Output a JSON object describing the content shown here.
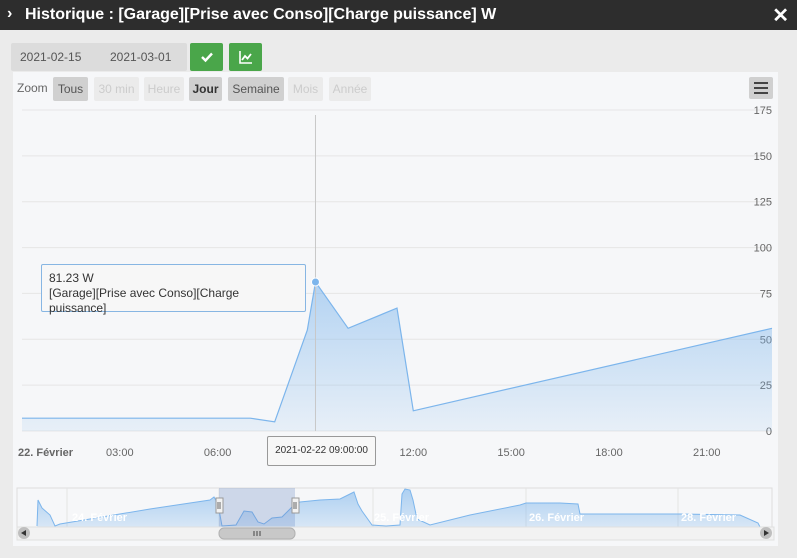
{
  "window": {
    "title": "Historique : [Garage][Prise avec Conso][Charge puissance] W"
  },
  "controls": {
    "date_start": "2021-02-15",
    "date_end": "2021-03-01"
  },
  "zoom": {
    "label": "Zoom",
    "buttons": [
      {
        "label": "Tous",
        "enabled": true,
        "selected": false
      },
      {
        "label": "30 min",
        "enabled": false,
        "selected": false
      },
      {
        "label": "Heure",
        "enabled": false,
        "selected": false
      },
      {
        "label": "Jour",
        "enabled": true,
        "selected": true
      },
      {
        "label": "Semaine",
        "enabled": true,
        "selected": false
      },
      {
        "label": "Mois",
        "enabled": false,
        "selected": false
      },
      {
        "label": "Année",
        "enabled": false,
        "selected": false
      }
    ]
  },
  "tooltip": {
    "value": "81.23 W",
    "series": "[Garage][Prise avec Conso][Charge puissance]"
  },
  "crosshair_label": "2021-02-22 09:00:00",
  "navigator": {
    "labels": [
      "24. Février",
      "25. Février",
      "26. Février",
      "28. Février"
    ]
  },
  "colors": {
    "line": "#7cb5ec",
    "accent_green": "#4aa64a",
    "titlebar": "#2d2d2d"
  },
  "chart_data": {
    "type": "area",
    "series": [
      {
        "name": "[Garage][Prise avec Conso][Charge puissance]",
        "unit": "W",
        "x": [
          "2021-02-22 00:00",
          "2021-02-22 07:00",
          "2021-02-22 07:45",
          "2021-02-22 08:45",
          "2021-02-22 09:00",
          "2021-02-22 10:00",
          "2021-02-22 11:30",
          "2021-02-22 12:00",
          "2021-02-22 23:00"
        ],
        "y": [
          7,
          7,
          5,
          55,
          81.23,
          56,
          67,
          11,
          56
        ]
      }
    ],
    "x_tick_labels": [
      "22. Février",
      "03:00",
      "06:00",
      "09:00",
      "12:00",
      "15:00",
      "18:00",
      "21:00"
    ],
    "y_tick_labels": [
      "0",
      "25",
      "50",
      "75",
      "100",
      "125",
      "150",
      "175"
    ],
    "ylim": [
      0,
      175
    ],
    "grid": true,
    "legend": "none"
  }
}
